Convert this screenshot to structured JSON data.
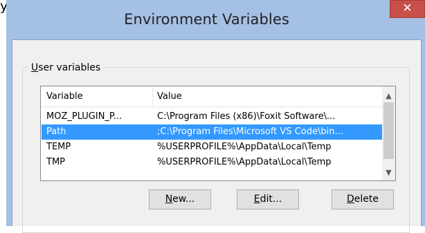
{
  "background_window": {
    "title_fragment": "y"
  },
  "dialog": {
    "title": "Environment Variables",
    "close_glyph": "✕"
  },
  "group": {
    "label_first": "U",
    "label_rest": "ser variables"
  },
  "list": {
    "columns": [
      "Variable",
      "Value"
    ],
    "rows": [
      {
        "variable": "MOZ_PLUGIN_P...",
        "value": "C:\\Program Files (x86)\\Foxit Software\\...",
        "selected": false
      },
      {
        "variable": "Path",
        "value": ";C:\\Program Files\\Microsoft VS Code\\bin...",
        "selected": true
      },
      {
        "variable": "TEMP",
        "value": "%USERPROFILE%\\AppData\\Local\\Temp",
        "selected": false
      },
      {
        "variable": "TMP",
        "value": "%USERPROFILE%\\AppData\\Local\\Temp",
        "selected": false
      }
    ]
  },
  "buttons": {
    "new_first": "N",
    "new_rest": "ew...",
    "edit_first": "E",
    "edit_rest": "dit...",
    "delete_first": "D",
    "delete_rest": "elete"
  },
  "colors": {
    "title_bar": "#a5c0e5",
    "close_button": "#c7504a",
    "selection": "#3399ff"
  },
  "icons": {
    "close": "close-icon",
    "scroll_up": "scroll-up-icon",
    "scroll_down": "scroll-down-icon"
  }
}
